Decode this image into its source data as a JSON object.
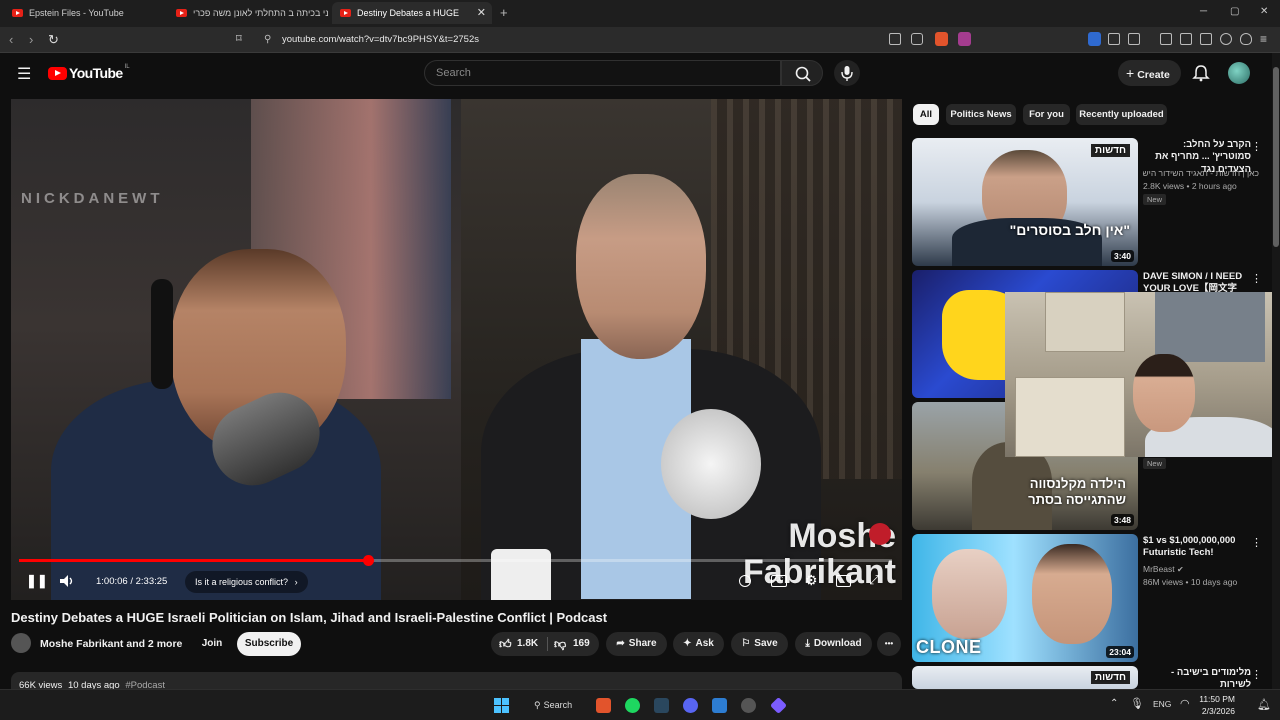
{
  "browser": {
    "tabs": [
      {
        "title": "Epstein Files - YouTube"
      },
      {
        "title": "אני בכיתה ב התחלתי לאונן משה פכרי"
      },
      {
        "title": "Destiny Debates a HUGE Israeli Politician"
      }
    ],
    "url": "youtube.com/watch?v=dtv7bc9PHSY&t=2752s",
    "window_controls": {
      "minimize": "─",
      "restore": "▢",
      "close": "✕"
    }
  },
  "header": {
    "logo": "YouTube",
    "region": "IL",
    "search_placeholder": "Search",
    "create_label": "Create"
  },
  "player": {
    "watermark": "NICKDANEWT",
    "lower_third_line1": "Moshe",
    "lower_third_line2": "Fabrikant",
    "time_current": "1:00:06",
    "time_separator": " / ",
    "time_total": "2:33:25",
    "chapter": "Is it a religious conflict?",
    "progress_fraction": 0.4
  },
  "video": {
    "title": "Destiny Debates a HUGE Israeli Politician on Islam, Jihad and Israeli-Palestine Conflict | Podcast",
    "channel": "Moshe Fabrikant and 2 more",
    "join_label": "Join",
    "subscribe_label": "Subscribe",
    "likes": "1.8K",
    "dislikes": "169",
    "share_label": "Share",
    "ask_label": "Ask",
    "save_label": "Save",
    "download_label": "Download",
    "more_label": "•••",
    "views": "66K views",
    "age": "10 days ago",
    "hashtag": "#Podcast"
  },
  "chips": [
    {
      "label": "All",
      "selected": true
    },
    {
      "label": "Politics News",
      "selected": false
    },
    {
      "label": "For you",
      "selected": false
    },
    {
      "label": "Recently uploaded",
      "selected": false
    }
  ],
  "recommendations": [
    {
      "title": "הקרב על החלב: סמוטריץ' ... מחריף את הצעדים נגד",
      "channel": "כאן | חדשות - תאגיד השידור הישרא...",
      "views": "2.8K views",
      "age": "2 hours ago",
      "badge": "New",
      "duration": "3:40",
      "thumb_text": "\"אין חלב בסוסרים\"",
      "thumb_tag": "חדשות"
    },
    {
      "title": "DAVE SIMON / I NEED YOUR LOVE【岡文字",
      "channel": "",
      "views": "",
      "age": "",
      "badge": "New",
      "duration": "",
      "thumb_text": "",
      "thumb_tag": ""
    },
    {
      "title": "",
      "channel": "",
      "views": "",
      "age": "",
      "badge": "",
      "duration": "3:48",
      "thumb_text": "הילדה מקלנסווה שהתגייסה בסתר",
      "thumb_tag": ""
    },
    {
      "title": "$1 vs $1,000,000,000 Futuristic Tech!",
      "channel": "MrBeast",
      "views": "86M views",
      "age": "10 days ago",
      "badge": "",
      "duration": "23:04",
      "thumb_text": "CLONE",
      "thumb_tag": ""
    },
    {
      "title": "מלימודים בישיבה - לשירות",
      "channel": "",
      "views": "",
      "age": "",
      "badge": "",
      "duration": "",
      "thumb_text": "",
      "thumb_tag": "חדשות"
    }
  ],
  "taskbar": {
    "search_label": "Search",
    "lang": "ENG",
    "time": "11:50 PM",
    "date": "2/3/2026"
  },
  "colors": {
    "accent_red": "#ff0000",
    "bg": "#0f0f0f",
    "chip_bg": "#272727"
  }
}
